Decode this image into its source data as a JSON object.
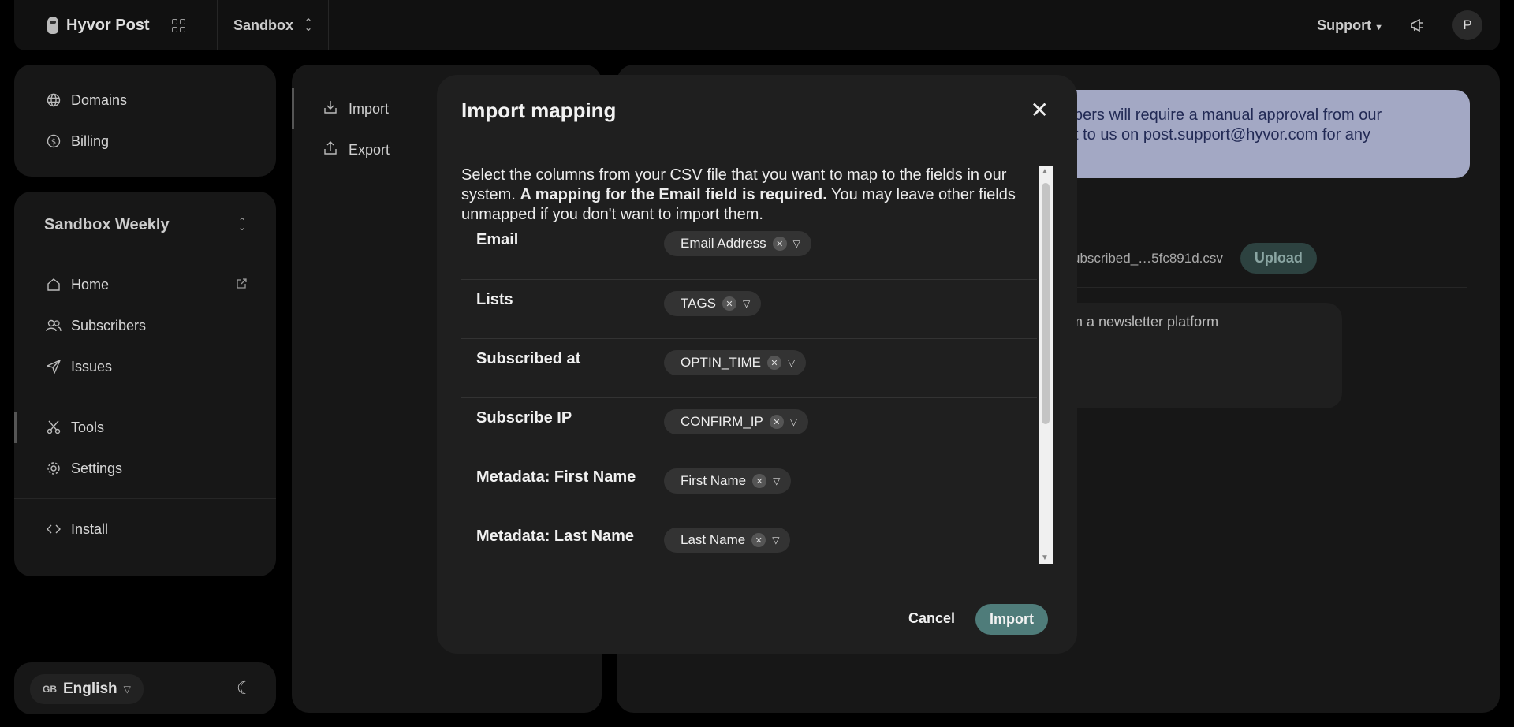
{
  "topbar": {
    "app_name": "Hyvor Post",
    "project": "Sandbox",
    "support": "Support",
    "avatar_initial": "P"
  },
  "sidebar": {
    "top_items": [
      {
        "label": "Domains",
        "icon": "globe-icon"
      },
      {
        "label": "Billing",
        "icon": "dollar-circle-icon"
      }
    ],
    "newsletter_name": "Sandbox Weekly",
    "main_items": [
      {
        "label": "Home",
        "icon": "home-icon"
      },
      {
        "label": "Subscribers",
        "icon": "users-icon"
      },
      {
        "label": "Issues",
        "icon": "send-icon"
      }
    ],
    "tool_items": [
      {
        "label": "Tools",
        "icon": "scissors-icon",
        "active": true
      },
      {
        "label": "Settings",
        "icon": "gear-icon"
      }
    ],
    "install": {
      "label": "Install",
      "icon": "code-icon"
    },
    "language": {
      "flag": "GB",
      "label": "English"
    }
  },
  "tools_menu": [
    {
      "label": "Import",
      "icon": "import-icon",
      "active": true
    },
    {
      "label": "Export",
      "icon": "export-icon"
    }
  ],
  "background_content": {
    "banner_line1": "bers will require a manual approval from our",
    "banner_line2": "t to us on post.support@hyvor.com for any",
    "file_name": "ubscribed_…5fc891d.csv",
    "upload_label": "Upload",
    "textarea_text": "om a newsletter platform"
  },
  "modal": {
    "title": "Import mapping",
    "desc_part1": "Select the columns from your CSV file that you want to map to the fields in our system. ",
    "desc_bold": "A mapping for the Email field is required.",
    "desc_part2": " You may leave other fields unmapped if you don't want to import them.",
    "mappings": [
      {
        "field": "Email",
        "column": "Email Address"
      },
      {
        "field": "Lists",
        "column": "TAGS"
      },
      {
        "field": "Subscribed at",
        "column": "OPTIN_TIME"
      },
      {
        "field": "Subscribe IP",
        "column": "CONFIRM_IP"
      },
      {
        "field": "Metadata: First Name",
        "column": "First Name"
      },
      {
        "field": "Metadata: Last Name",
        "column": "Last Name"
      }
    ],
    "cancel_label": "Cancel",
    "import_label": "Import"
  }
}
